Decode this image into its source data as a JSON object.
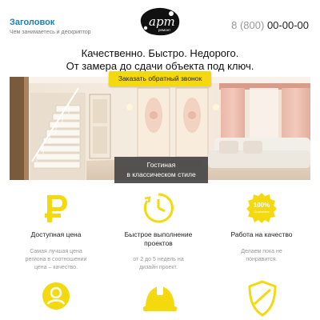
{
  "header": {
    "title": "Заголовок",
    "descriptor": "Чем занимаетесь и дескриптор",
    "logo_text": "арт",
    "logo_subtext": "ремонт",
    "phone_prefix": "8 (800)",
    "phone_number": "00-00-00"
  },
  "hero": {
    "headline": "Качественно. Быстро. Недорого.",
    "subline": "От замера до сдачи объекта под ключ.",
    "cta_label": "Заказать обратный звонок",
    "caption_line1": "Гостиная",
    "caption_line2": "в классическом стиле"
  },
  "features": [
    {
      "icon": "ruble-icon",
      "title_line1": "Доступная цена",
      "title_line2": "",
      "desc_line1": "Самая лучшая цена",
      "desc_line2": "региона в соотношении",
      "desc_line3": "цена – качество."
    },
    {
      "icon": "clock-icon",
      "title_line1": "Быстрое выполнение",
      "title_line2": "проектов",
      "desc_line1": "от 2 до 5 недель на",
      "desc_line2": "дизайн проект.",
      "desc_line3": ""
    },
    {
      "icon": "quality-badge-icon",
      "badge_text_top": "100%",
      "badge_text_bottom": "Guarantee",
      "title_line1": "Работа на качество",
      "title_line2": "",
      "desc_line1": "Делаем пока не",
      "desc_line2": "понравится.",
      "desc_line3": ""
    }
  ],
  "colors": {
    "accent": "#f4d90e",
    "link": "#1c7fb8",
    "caption_bg": "#464646"
  }
}
